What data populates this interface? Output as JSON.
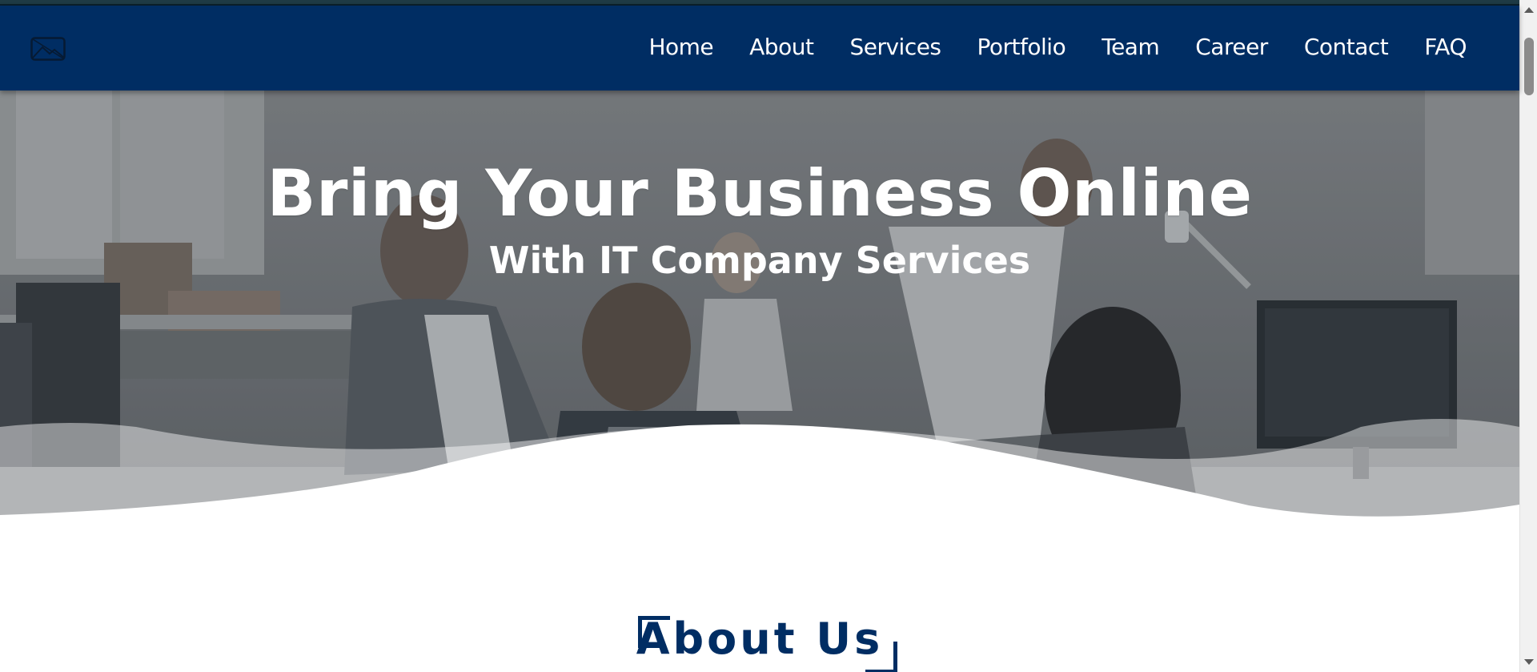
{
  "nav": {
    "logo_icon": "broken-image-icon",
    "items": [
      "Home",
      "About",
      "Services",
      "Portfolio",
      "Team",
      "Career",
      "Contact",
      "FAQ"
    ]
  },
  "hero": {
    "title": "Bring Your Business Online",
    "subtitle": "With IT Company Services"
  },
  "about": {
    "heading": "About Us"
  },
  "colors": {
    "brand": "#002d63",
    "text_on_brand": "#ffffff",
    "page_bg": "#ffffff"
  }
}
